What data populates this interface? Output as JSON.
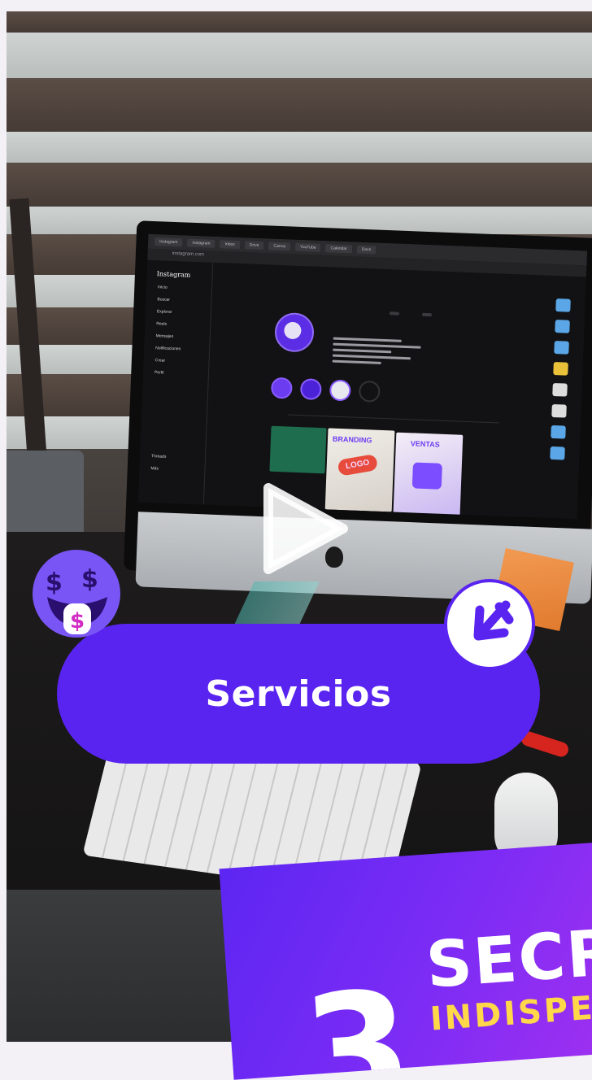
{
  "video": {
    "monitor_screen": {
      "browser_tabs": [
        "Instagram",
        "Instagram",
        "Inbox",
        "Drive",
        "Canva",
        "YouTube",
        "Calendar",
        "Docs"
      ],
      "url": "instagram.com",
      "app_name": "Instagram",
      "nav_items": [
        "Inicio",
        "Buscar",
        "Explorar",
        "Reels",
        "Mensajes",
        "Notificaciones",
        "Crear",
        "Perfil"
      ],
      "nav_bottom": [
        "Threads",
        "Más"
      ],
      "profile": {
        "username": "",
        "edit_button": "",
        "archive_button": "",
        "stats": [
          "",
          "",
          ""
        ]
      },
      "highlights": [
        "",
        "",
        "",
        ""
      ],
      "post_words": {
        "branding": "BRANDING",
        "logo": "LOGO",
        "ventas": "VENTAS"
      }
    }
  },
  "overlay": {
    "pill_label": "Servicios",
    "promo": {
      "number": "3",
      "title": "SECR",
      "subtitle": "INDISPE"
    }
  },
  "colors": {
    "accent": "#5a24f0",
    "sticker_purple": "#7a55f6",
    "promo_gradient_end": "#9e30f0"
  },
  "icons": {
    "play": "play-triangle-icon",
    "money_face": "money-mouth-face-icon",
    "arrow": "arrow-down-left-icon"
  }
}
